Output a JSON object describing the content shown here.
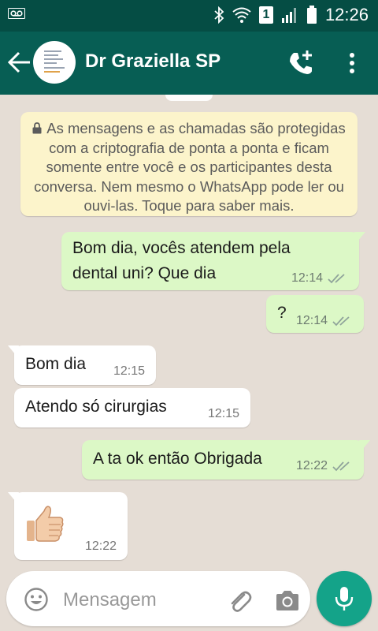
{
  "status_bar": {
    "time": "12:26",
    "sim_slot": "1",
    "icons": [
      "voicemail-icon",
      "bluetooth-icon",
      "wifi-icon",
      "sim-1-icon",
      "signal-icon",
      "battery-icon"
    ]
  },
  "header": {
    "contact_name": "Dr Graziella SP",
    "icons": [
      "back-arrow-icon",
      "add-call-icon",
      "more-options-icon"
    ]
  },
  "encryption_notice": {
    "text": "As mensagens e as chamadas são protegidas com a criptografia de ponta a ponta e ficam somente entre você e os participantes desta conversa. Nem mesmo o WhatsApp pode ler ou ouvi-las. Toque para saber mais."
  },
  "messages": [
    {
      "direction": "out",
      "line1": "Bom dia, vocês atendem pela",
      "line2": "dental uni? Que dia",
      "time": "12:14",
      "status": "read"
    },
    {
      "direction": "out",
      "text": "?",
      "time": "12:14",
      "status": "read"
    },
    {
      "direction": "in",
      "text": "Bom dia",
      "time": "12:15"
    },
    {
      "direction": "in",
      "text": "Atendo só cirurgias",
      "time": "12:15"
    },
    {
      "direction": "out",
      "text": "A ta ok então Obrigada",
      "time": "12:22",
      "status": "read"
    },
    {
      "direction": "in",
      "emoji": "thumbs-up",
      "time": "12:22"
    }
  ],
  "composer": {
    "placeholder": "Mensagem",
    "icons": [
      "emoji-icon",
      "attach-icon",
      "camera-icon",
      "microphone-icon"
    ]
  },
  "colors": {
    "status_bar": "#054d44",
    "app_bar": "#075e54",
    "chat_background": "#e5ddd5",
    "outgoing_bubble": "#dcf8c6",
    "incoming_bubble": "#ffffff",
    "notice_bubble": "#fcf4cb",
    "mic_button": "#14a389",
    "read_ticks": "#8fa39a"
  }
}
